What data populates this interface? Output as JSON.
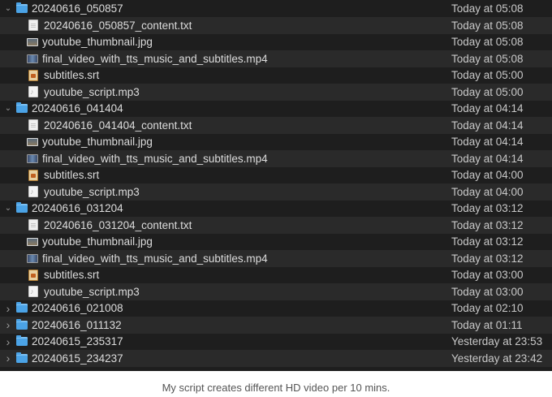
{
  "rows": [
    {
      "kind": "folder",
      "expanded": true,
      "name": "20240616_050857",
      "date": "Today at 05:08",
      "icon": "folder-icon"
    },
    {
      "kind": "file",
      "name": "20240616_050857_content.txt",
      "date": "Today at 05:08",
      "icon": "text-file-icon"
    },
    {
      "kind": "file",
      "name": "youtube_thumbnail.jpg",
      "date": "Today at 05:08",
      "icon": "image-file-icon"
    },
    {
      "kind": "file",
      "name": "final_video_with_tts_music_and_subtitles.mp4",
      "date": "Today at 05:08",
      "icon": "video-file-icon"
    },
    {
      "kind": "file",
      "name": "subtitles.srt",
      "date": "Today at 05:00",
      "icon": "subtitle-file-icon"
    },
    {
      "kind": "file",
      "name": "youtube_script.mp3",
      "date": "Today at 05:00",
      "icon": "audio-file-icon"
    },
    {
      "kind": "folder",
      "expanded": true,
      "name": "20240616_041404",
      "date": "Today at 04:14",
      "icon": "folder-icon"
    },
    {
      "kind": "file",
      "name": "20240616_041404_content.txt",
      "date": "Today at 04:14",
      "icon": "text-file-icon"
    },
    {
      "kind": "file",
      "name": "youtube_thumbnail.jpg",
      "date": "Today at 04:14",
      "icon": "image-file-icon"
    },
    {
      "kind": "file",
      "name": "final_video_with_tts_music_and_subtitles.mp4",
      "date": "Today at 04:14",
      "icon": "video-file-icon"
    },
    {
      "kind": "file",
      "name": "subtitles.srt",
      "date": "Today at 04:00",
      "icon": "subtitle-file-icon"
    },
    {
      "kind": "file",
      "name": "youtube_script.mp3",
      "date": "Today at 04:00",
      "icon": "audio-file-icon"
    },
    {
      "kind": "folder",
      "expanded": true,
      "name": "20240616_031204",
      "date": "Today at 03:12",
      "icon": "folder-icon"
    },
    {
      "kind": "file",
      "name": "20240616_031204_content.txt",
      "date": "Today at 03:12",
      "icon": "text-file-icon"
    },
    {
      "kind": "file",
      "name": "youtube_thumbnail.jpg",
      "date": "Today at 03:12",
      "icon": "image-file-icon"
    },
    {
      "kind": "file",
      "name": "final_video_with_tts_music_and_subtitles.mp4",
      "date": "Today at 03:12",
      "icon": "video-file-icon"
    },
    {
      "kind": "file",
      "name": "subtitles.srt",
      "date": "Today at 03:00",
      "icon": "subtitle-file-icon"
    },
    {
      "kind": "file",
      "name": "youtube_script.mp3",
      "date": "Today at 03:00",
      "icon": "audio-file-icon"
    },
    {
      "kind": "folder",
      "expanded": false,
      "name": "20240616_021008",
      "date": "Today at 02:10",
      "icon": "folder-icon"
    },
    {
      "kind": "folder",
      "expanded": false,
      "name": "20240616_011132",
      "date": "Today at 01:11",
      "icon": "folder-icon"
    },
    {
      "kind": "folder",
      "expanded": false,
      "name": "20240615_235317",
      "date": "Yesterday at 23:53",
      "icon": "folder-icon"
    },
    {
      "kind": "folder",
      "expanded": false,
      "name": "20240615_234237",
      "date": "Yesterday at 23:42",
      "icon": "folder-icon"
    }
  ],
  "caption": "My script creates different HD video per 10 mins.",
  "colors": {
    "background": "#1e1e1e",
    "alt_row": "#2a2a2a",
    "folder": "#4ba3e6",
    "text": "#dcdcdc"
  }
}
